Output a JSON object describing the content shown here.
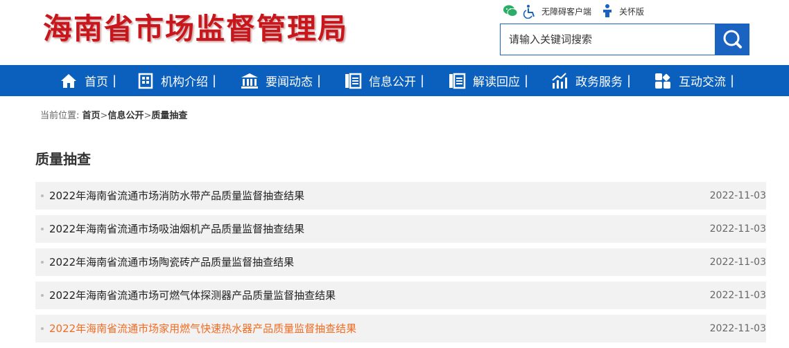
{
  "header": {
    "logo_text": "海南省市场监督管理局",
    "links": [
      {
        "icon": "wechat-icon",
        "label": ""
      },
      {
        "icon": "accessibility-icon",
        "label": "无障碍客户端"
      },
      {
        "icon": "elder-care-icon",
        "label": "关怀版"
      }
    ],
    "search": {
      "placeholder": "请输入关键词搜索"
    }
  },
  "nav": [
    {
      "label": "首页",
      "icon": "home-icon"
    },
    {
      "label": "机构介绍",
      "icon": "building-icon"
    },
    {
      "label": "要闻动态",
      "icon": "bank-icon"
    },
    {
      "label": "信息公开",
      "icon": "document-list-icon"
    },
    {
      "label": "解读回应",
      "icon": "doc-lines-icon"
    },
    {
      "label": "政务服务",
      "icon": "chart-icon"
    },
    {
      "label": "互动交流",
      "icon": "grid-icon"
    }
  ],
  "breadcrumb": {
    "prefix": "当前位置:",
    "items": [
      "首页",
      "信息公开",
      "质量抽查"
    ]
  },
  "page_title": "质量抽查",
  "articles": [
    {
      "title": "2022年海南省流通市场消防水带产品质量监督抽查结果",
      "date": "2022-11-03"
    },
    {
      "title": "2022年海南省流通市场吸油烟机产品质量监督抽查结果",
      "date": "2022-11-03"
    },
    {
      "title": "2022年海南省流通市场陶瓷砖产品质量监督抽查结果",
      "date": "2022-11-03"
    },
    {
      "title": "2022年海南省流通市场可燃气体探测器产品质量监督抽查结果",
      "date": "2022-11-03"
    },
    {
      "title": "2022年海南省流通市场家用燃气快速热水器产品质量监督抽查结果",
      "date": "2022-11-03"
    }
  ],
  "colors": {
    "brand_red": "#c8161d",
    "nav_blue": "#0b5fbd",
    "highlight": "#f26c22"
  }
}
